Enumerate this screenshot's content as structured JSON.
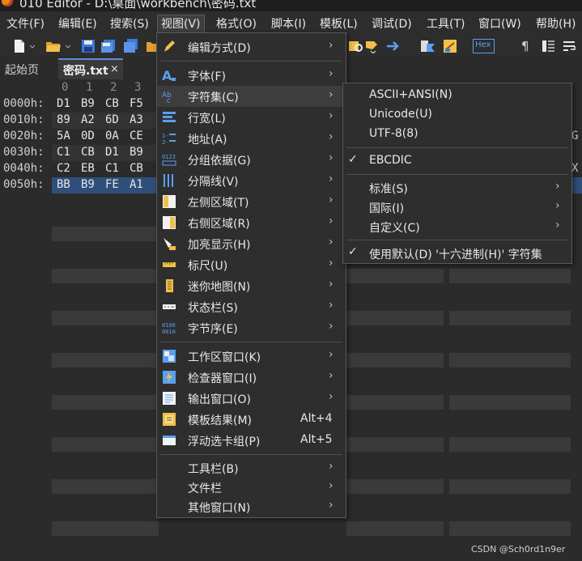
{
  "titlebar": {
    "title": "010 Editor - D:\\桌面\\workbench\\密码.txt"
  },
  "menubar": [
    "文件(F)",
    "编辑(E)",
    "搜索(S)",
    "视图(V)",
    "格式(O)",
    "脚本(I)",
    "模板(L)",
    "调试(D)",
    "工具(T)",
    "窗口(W)",
    "帮助(H)"
  ],
  "toolbar": {
    "hex_label": "Hex"
  },
  "tabs": {
    "start": "起始页",
    "file": "密码.txt",
    "close": "×"
  },
  "hex": {
    "column_headers": [
      "0",
      "1",
      "2",
      "3"
    ],
    "rows": [
      {
        "address": "0000h:",
        "bytes": [
          "D1",
          "B9",
          "CB",
          "F5"
        ],
        "tail": ""
      },
      {
        "address": "0010h:",
        "bytes": [
          "89",
          "A2",
          "6D",
          "A3"
        ],
        "tail": ""
      },
      {
        "address": "0020h:",
        "bytes": [
          "5A",
          "0D",
          "0A",
          "CE"
        ],
        "tail": "G"
      },
      {
        "address": "0030h:",
        "bytes": [
          "C1",
          "CB",
          "D1",
          "B9"
        ],
        "tail": ""
      },
      {
        "address": "0040h:",
        "bytes": [
          "C2",
          "EB",
          "C1",
          "CB"
        ],
        "tail": "X"
      },
      {
        "address": "0050h:",
        "bytes": [
          "BB",
          "B9",
          "FE",
          "A1"
        ],
        "tail": ""
      }
    ]
  },
  "view_menu": {
    "items": [
      {
        "label": "编辑方式(D)",
        "shortcut": "",
        "submenu": true,
        "icon": "pencil-icon"
      },
      {
        "label": "字体(F)",
        "shortcut": "",
        "submenu": true,
        "icon": "font-icon"
      },
      {
        "label": "字符集(C)",
        "shortcut": "",
        "submenu": true,
        "icon": "charset-icon"
      },
      {
        "label": "行宽(L)",
        "shortcut": "",
        "submenu": true,
        "icon": "line-width-icon"
      },
      {
        "label": "地址(A)",
        "shortcut": "",
        "submenu": true,
        "icon": "address-icon"
      },
      {
        "label": "分组依据(G)",
        "shortcut": "",
        "submenu": true,
        "icon": "group-icon"
      },
      {
        "label": "分隔线(V)",
        "shortcut": "",
        "submenu": true,
        "icon": "divider-icon"
      },
      {
        "label": "左侧区域(T)",
        "shortcut": "",
        "submenu": true,
        "icon": "left-area-icon"
      },
      {
        "label": "右侧区域(R)",
        "shortcut": "",
        "submenu": true,
        "icon": "right-area-icon"
      },
      {
        "label": "加亮显示(H)",
        "shortcut": "",
        "submenu": true,
        "icon": "highlight-icon"
      },
      {
        "label": "标尺(U)",
        "shortcut": "",
        "submenu": true,
        "icon": "ruler-icon"
      },
      {
        "label": "迷你地图(N)",
        "shortcut": "",
        "submenu": true,
        "icon": "minimap-icon"
      },
      {
        "label": "状态栏(S)",
        "shortcut": "",
        "submenu": true,
        "icon": "statusbar-icon"
      },
      {
        "label": "字节序(E)",
        "shortcut": "",
        "submenu": true,
        "icon": "byte-order-icon"
      },
      {
        "label": "工作区窗口(K)",
        "shortcut": "",
        "submenu": true,
        "icon": "workspace-icon"
      },
      {
        "label": "检查器窗口(I)",
        "shortcut": "",
        "submenu": true,
        "icon": "inspector-icon"
      },
      {
        "label": "输出窗口(O)",
        "shortcut": "",
        "submenu": true,
        "icon": "output-icon"
      },
      {
        "label": "模板结果(M)",
        "shortcut": "Alt+4",
        "submenu": false,
        "icon": "template-results-icon"
      },
      {
        "label": "浮动选卡组(P)",
        "shortcut": "Alt+5",
        "submenu": false,
        "icon": "float-tabs-icon"
      },
      {
        "label": "工具栏(B)",
        "shortcut": "",
        "submenu": true,
        "icon": ""
      },
      {
        "label": "文件栏",
        "shortcut": "",
        "submenu": true,
        "icon": ""
      },
      {
        "label": "其他窗口(N)",
        "shortcut": "",
        "submenu": true,
        "icon": ""
      }
    ]
  },
  "charset_menu": {
    "items": [
      {
        "label": "ASCII+ANSI(N)",
        "checked": false,
        "submenu": false
      },
      {
        "label": "Unicode(U)",
        "checked": false,
        "submenu": false
      },
      {
        "label": "UTF-8(8)",
        "checked": false,
        "submenu": false
      },
      {
        "label": "EBCDIC",
        "checked": true,
        "submenu": false
      },
      {
        "label": "标准(S)",
        "checked": false,
        "submenu": true
      },
      {
        "label": "国际(I)",
        "checked": false,
        "submenu": true
      },
      {
        "label": "自定义(C)",
        "checked": false,
        "submenu": true
      },
      {
        "label": "使用默认(D) '十六进制(H)' 字符集",
        "checked": true,
        "submenu": false
      }
    ]
  },
  "check_mark": "✓",
  "submenu_arrow": "›",
  "watermark": "CSDN @Sch0rd1n9er"
}
